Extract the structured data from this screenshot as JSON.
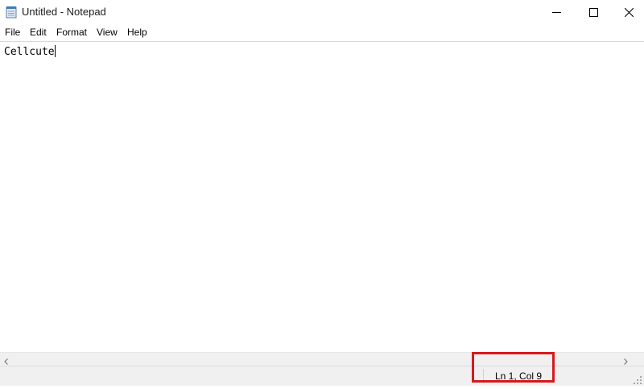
{
  "window": {
    "title": "Untitled - Notepad",
    "icon": "notepad-icon"
  },
  "controls": {
    "minimize_icon": "minimize-icon",
    "maximize_icon": "maximize-icon",
    "close_icon": "close-icon"
  },
  "menu": {
    "items": [
      {
        "label": "File"
      },
      {
        "label": "Edit"
      },
      {
        "label": "Format"
      },
      {
        "label": "View"
      },
      {
        "label": "Help"
      }
    ]
  },
  "editor": {
    "content": "Cellcute"
  },
  "status": {
    "position": "Ln 1, Col 9"
  },
  "annotation": {
    "color": "#d7191c"
  }
}
